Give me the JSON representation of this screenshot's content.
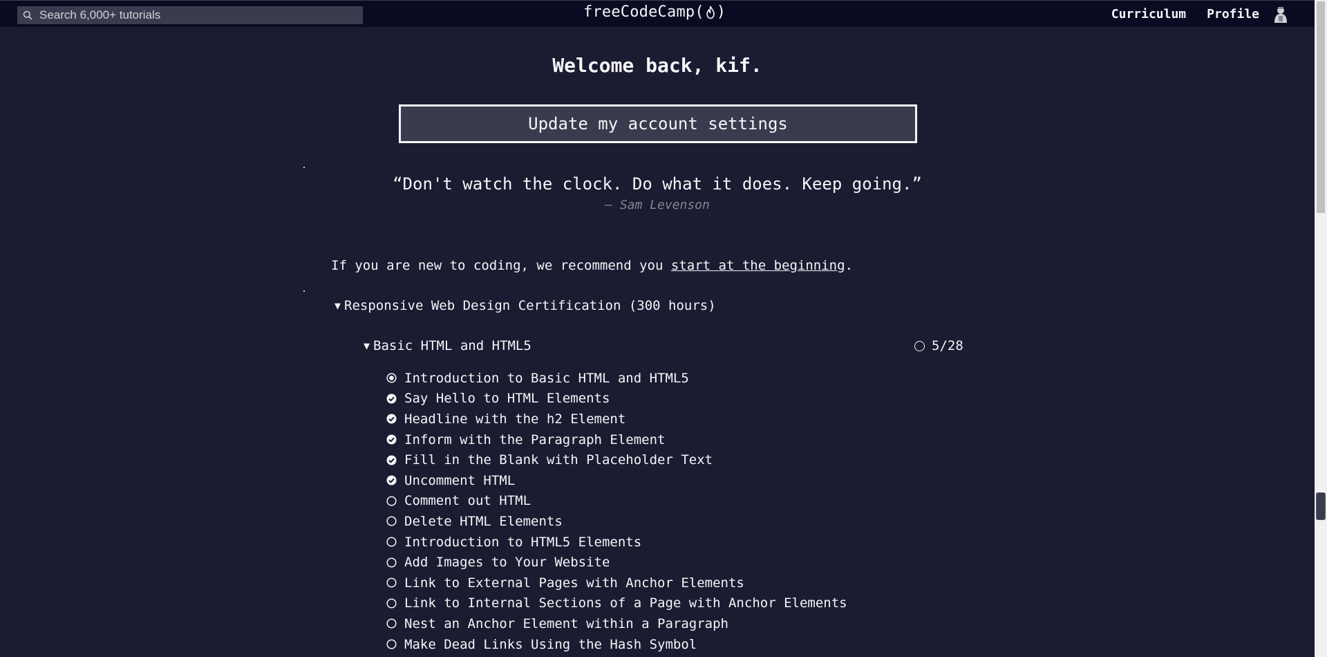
{
  "nav": {
    "search_placeholder": "Search 6,000+ tutorials",
    "brand_left": "freeCodeCamp(",
    "brand_right": ")",
    "curriculum": "Curriculum",
    "profile": "Profile"
  },
  "main": {
    "welcome": "Welcome back, kif.",
    "settings_button": "Update my account settings",
    "quote": "“Don't watch the clock. Do what it does. Keep going.”",
    "quote_author": "— Sam Levenson",
    "intro_prefix": "If you are new to coding, we recommend you ",
    "intro_link": "start at the beginning",
    "intro_suffix": "."
  },
  "certification": {
    "title": "Responsive Web Design Certification (300 hours)",
    "block": {
      "title": "Basic HTML and HTML5",
      "progress": "5/28",
      "challenges": [
        {
          "title": "Introduction to Basic HTML and HTML5",
          "status": "current"
        },
        {
          "title": "Say Hello to HTML Elements",
          "status": "done"
        },
        {
          "title": "Headline with the h2 Element",
          "status": "done"
        },
        {
          "title": "Inform with the Paragraph Element",
          "status": "done"
        },
        {
          "title": "Fill in the Blank with Placeholder Text",
          "status": "done"
        },
        {
          "title": "Uncomment HTML",
          "status": "done"
        },
        {
          "title": "Comment out HTML",
          "status": "todo"
        },
        {
          "title": "Delete HTML Elements",
          "status": "todo"
        },
        {
          "title": "Introduction to HTML5 Elements",
          "status": "todo"
        },
        {
          "title": "Add Images to Your Website",
          "status": "todo"
        },
        {
          "title": "Link to External Pages with Anchor Elements",
          "status": "todo"
        },
        {
          "title": "Link to Internal Sections of a Page with Anchor Elements",
          "status": "todo"
        },
        {
          "title": "Nest an Anchor Element within a Paragraph",
          "status": "todo"
        },
        {
          "title": "Make Dead Links Using the Hash Symbol",
          "status": "todo"
        }
      ]
    }
  },
  "colors": {
    "background": "#1b1b32",
    "nav_background": "#0a0a23",
    "button_background": "#3b3b4f",
    "text": "#f5f6f7",
    "muted": "#858591"
  },
  "icons": {
    "search": "search-icon",
    "flame": "flame-icon",
    "avatar": "avatar",
    "done": "check-circle-icon",
    "current": "radio-dot-icon",
    "todo": "empty-circle-icon"
  }
}
